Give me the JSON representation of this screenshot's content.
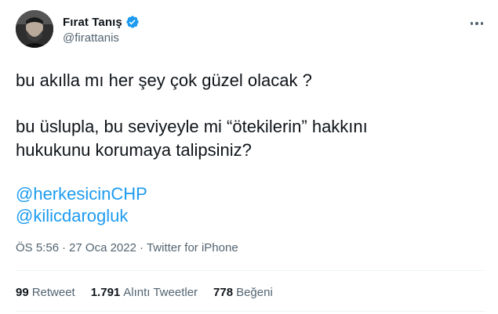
{
  "author": {
    "display_name": "Fırat Tanış",
    "handle": "@firattanis",
    "verified": true
  },
  "tweet": {
    "line1": "bu akılla mı her şey çok güzel olacak ?",
    "line2": "bu üslupla, bu seviyeyle mi “ötekilerin” hakkını",
    "line3": "hukukunu korumaya talipsiniz?",
    "mentions": [
      "@herkesicinCHP",
      "@kilicdarogluk"
    ]
  },
  "meta": {
    "time": "ÖS 5:56",
    "date": "27 Oca 2022",
    "separator": "·",
    "source": "Twitter for iPhone"
  },
  "stats": [
    {
      "count": "99",
      "label": "Retweet"
    },
    {
      "count": "1.791",
      "label": "Alıntı Tweetler"
    },
    {
      "count": "778",
      "label": "Beğeni"
    }
  ],
  "colors": {
    "text": "#0f1419",
    "secondary": "#536471",
    "link": "#1d9bf0",
    "verified": "#1d9bf0"
  },
  "icons": {
    "verified": "verified-badge-icon",
    "more": "more-options-icon"
  }
}
